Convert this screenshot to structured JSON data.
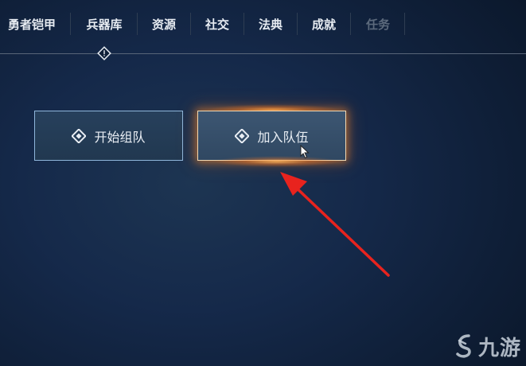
{
  "nav": {
    "tabs": [
      {
        "label": "勇者铠甲",
        "active": false,
        "disabled": false
      },
      {
        "label": "兵器库",
        "active": true,
        "disabled": false
      },
      {
        "label": "资源",
        "active": false,
        "disabled": false
      },
      {
        "label": "社交",
        "active": false,
        "disabled": false
      },
      {
        "label": "法典",
        "active": false,
        "disabled": false
      },
      {
        "label": "成就",
        "active": false,
        "disabled": false
      },
      {
        "label": "任务",
        "active": false,
        "disabled": true
      }
    ],
    "marker_icon": "alert-diamond-icon"
  },
  "buttons": {
    "start_team": {
      "label": "开始组队",
      "icon": "diamond-icon",
      "highlighted": false
    },
    "join_team": {
      "label": "加入队伍",
      "icon": "diamond-icon",
      "highlighted": true
    }
  },
  "annotation": {
    "type": "red-arrow",
    "color": "#e8231e",
    "target": "join_team"
  },
  "watermark": {
    "text": "九游",
    "logo": "jiuyou-logo"
  },
  "colors": {
    "background": "#15294a",
    "button_border": "#8fb6db",
    "highlight_glow": "#ff8c28",
    "text": "#e9eef4",
    "disabled_text": "#5c6a7c"
  }
}
